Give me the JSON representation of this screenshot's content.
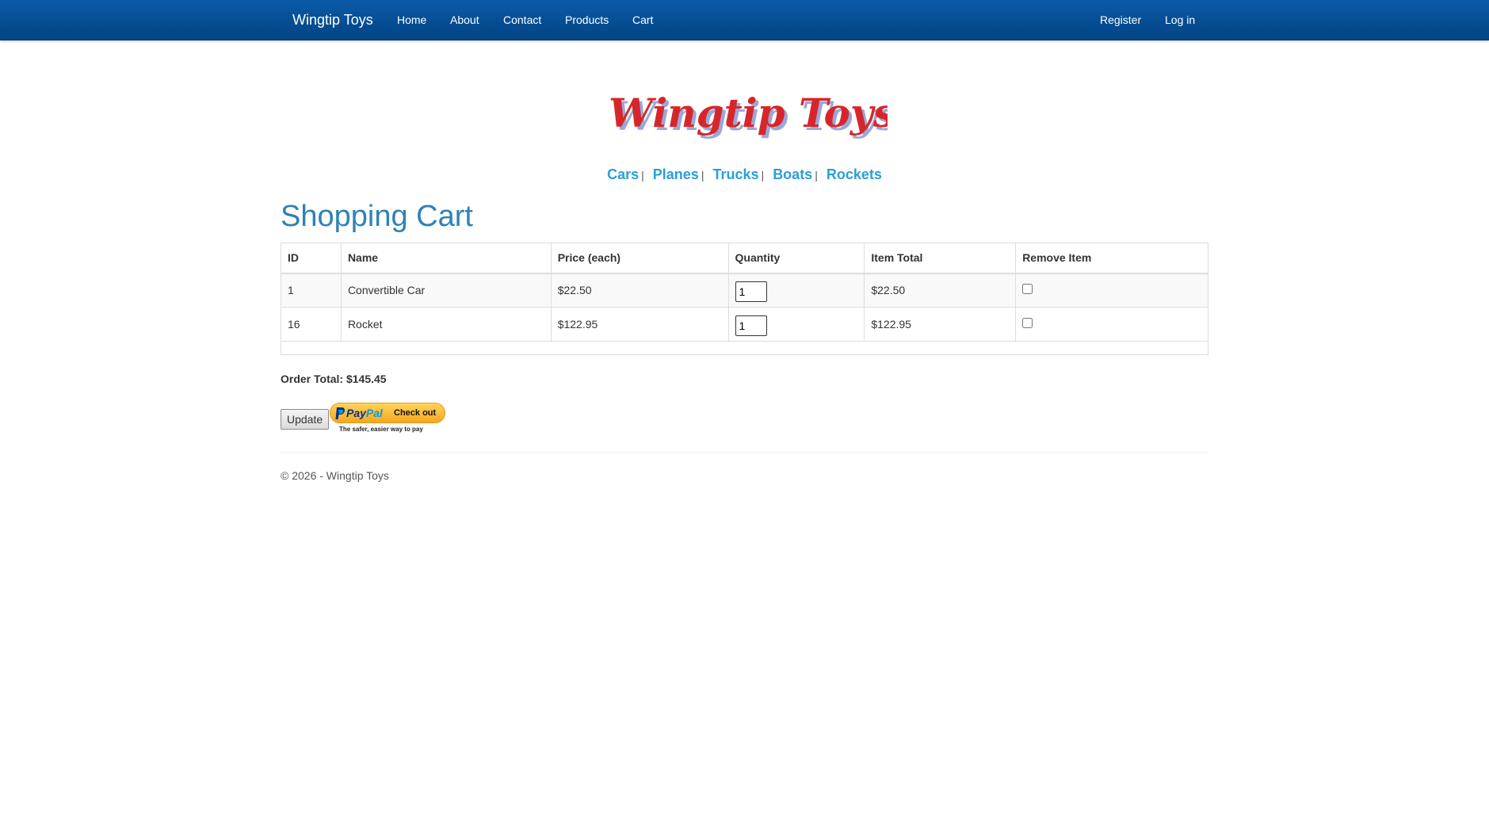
{
  "navbar": {
    "brand": "Wingtip Toys",
    "links": [
      "Home",
      "About",
      "Contact",
      "Products",
      "Cart"
    ],
    "register": "Register",
    "login": "Log in"
  },
  "logo": {
    "text": "Wingtip Toys",
    "color": "#d7262b"
  },
  "categories": [
    "Cars",
    "Planes",
    "Trucks",
    "Boats",
    "Rockets"
  ],
  "category_separator": "|",
  "page_title": "Shopping Cart",
  "table": {
    "headers": [
      "ID",
      "Name",
      "Price (each)",
      "Quantity",
      "Item Total",
      "Remove Item"
    ],
    "rows": [
      {
        "id": "1",
        "name": "Convertible Car",
        "price": "$22.50",
        "quantity": "1",
        "item_total": "$22.50",
        "remove": false
      },
      {
        "id": "16",
        "name": "Rocket",
        "price": "$122.95",
        "quantity": "1",
        "item_total": "$122.95",
        "remove": false
      }
    ]
  },
  "order_total": {
    "label": "Order Total:",
    "value": "$145.45"
  },
  "update_label": "Update",
  "paypal": {
    "pay": "Pay",
    "pal": "Pal",
    "checkout": "Check out",
    "tagline": "The safer, easier way to pay"
  },
  "footer": "© 2026 - Wingtip Toys",
  "colors": {
    "nav_bg": "#014483",
    "accent": "#2a9fd6",
    "title": "#2f82b6"
  }
}
